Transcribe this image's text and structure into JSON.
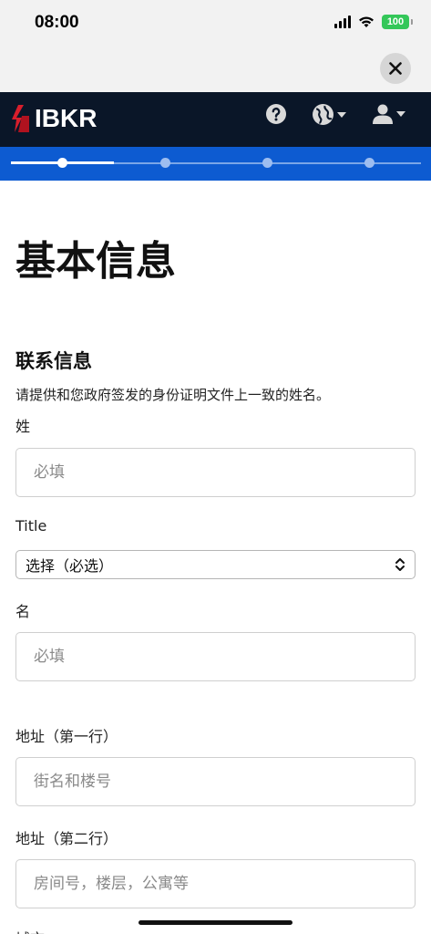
{
  "status_bar": {
    "time": "08:00",
    "battery": "100"
  },
  "header": {
    "logo_text": "IBKR"
  },
  "progress": {
    "steps_total": 4,
    "current_step": 1,
    "fill_fraction": 0.25
  },
  "page": {
    "title": "基本信息",
    "section_title": "联系信息",
    "section_desc": "请提供和您政府签发的身份证明文件上一致的姓名。"
  },
  "form": {
    "last_name": {
      "label": "姓",
      "placeholder": "必填"
    },
    "title": {
      "label": "Title",
      "selected": "选择（必选）"
    },
    "first_name": {
      "label": "名",
      "placeholder": "必填"
    },
    "address1": {
      "label": "地址（第一行）",
      "placeholder": "街名和楼号"
    },
    "address2": {
      "label": "地址（第二行）",
      "placeholder": "房间号，楼层，公寓等"
    },
    "city": {
      "label": "城市"
    }
  },
  "colors": {
    "header_bg": "#0a1628",
    "progress_bg": "#0d5bd1",
    "logo_red": "#d81e2c"
  }
}
